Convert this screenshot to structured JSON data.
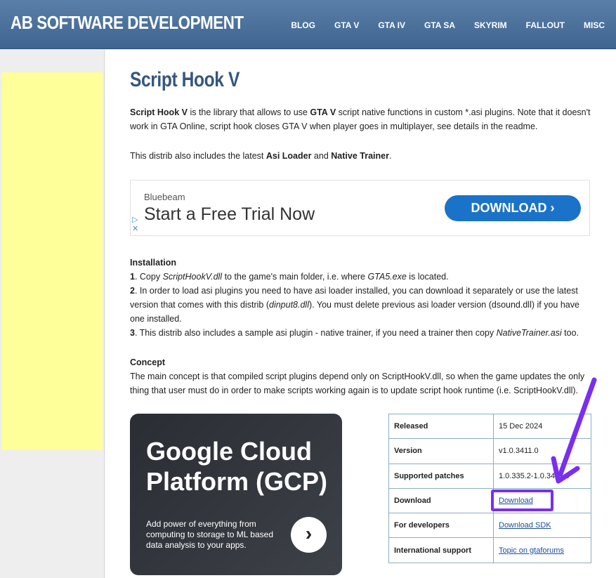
{
  "header": {
    "site_title": "AB SOFTWARE DEVELOPMENT",
    "nav": [
      "BLOG",
      "GTA V",
      "GTA IV",
      "GTA SA",
      "SKYRIM",
      "FALLOUT",
      "MISC"
    ]
  },
  "page": {
    "title": "Script Hook V",
    "intro": {
      "b1": "Script Hook V",
      "t1": " is the library that allows to use ",
      "b2": "GTA V",
      "t2": " script native functions in custom *.asi plugins. Note that it doesn't work in GTA Online, script hook closes GTA V when player goes in multiplayer, see details in the readme."
    },
    "distrib": {
      "t1": "This distrib also includes the latest ",
      "b1": "Asi Loader",
      "t2": " and ",
      "b2": "Native Trainer",
      "t3": "."
    },
    "installation": {
      "heading": "Installation",
      "s1_num": "1",
      "s1_a": ". Copy ",
      "s1_i1": "ScriptHookV.dll",
      "s1_b": " to the game's main folder, i.e. where ",
      "s1_i2": "GTA5.exe",
      "s1_c": " is located.",
      "s2_num": "2",
      "s2_a": ". In order to load asi plugins you need to have asi loader installed, you can download it separately or use the latest version that comes with this distrib (",
      "s2_i": "dinput8.dll",
      "s2_b": "). You must delete previous asi loader version (dsound.dll) if you have one installed.",
      "s3_num": "3",
      "s3_a": ". This distrib also includes a sample asi plugin - native trainer, if you need a trainer then copy ",
      "s3_i": "NativeTrainer.asi",
      "s3_b": " too."
    },
    "concept": {
      "heading": "Concept",
      "text": "The main concept is that compiled script plugins depend only on ScriptHookV.dll, so when the game updates the only thing that user must do in order to make scripts working again is to update script hook runtime (i.e. ScriptHookV.dll)."
    }
  },
  "ad_bluebeam": {
    "brand": "Bluebeam",
    "headline": "Start a Free Trial Now",
    "button": "DOWNLOAD ›"
  },
  "ad_gcp": {
    "title": "Google Cloud Platform (GCP)",
    "subtitle": "Add power of everything from computing to storage to ML based data analysis to your apps.",
    "button_glyph": "›"
  },
  "info_table": {
    "released_label": "Released",
    "released_value": "15 Dec 2024",
    "version_label": "Version",
    "version_value": "v1.0.3411.0",
    "patches_label": "Supported patches",
    "patches_value": "1.0.335.2-1.0.3411.0",
    "download_label": "Download",
    "download_link": "Download",
    "dev_label": "For developers",
    "dev_link": "Download SDK",
    "intl_label": "International support",
    "intl_link": "Topic on gtaforums"
  },
  "colors": {
    "header": "#4a6f9a",
    "title": "#35577f",
    "highlight": "#7a2ef0",
    "ad_yellow": "#ffff99",
    "ad_button": "#1a73c8"
  }
}
